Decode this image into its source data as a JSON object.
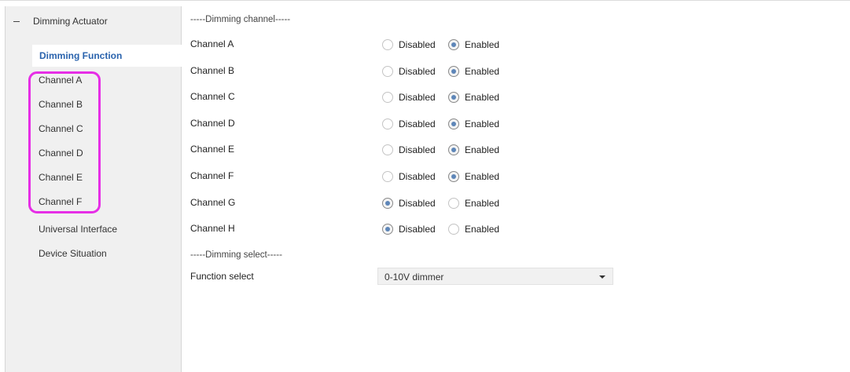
{
  "sidebar": {
    "root_label": "Dimming Actuator",
    "items": [
      {
        "label": "Dimming Function"
      },
      {
        "label": "Channel A"
      },
      {
        "label": "Channel B"
      },
      {
        "label": "Channel C"
      },
      {
        "label": "Channel D"
      },
      {
        "label": "Channel E"
      },
      {
        "label": "Channel F"
      },
      {
        "label": "Universal Interface"
      },
      {
        "label": "Device Situation"
      }
    ],
    "active_index": 0,
    "highlight_color": "#e62ee6",
    "active_color": "#2a63ad"
  },
  "main": {
    "section_channel": "-----Dimming channel-----",
    "option_disabled": "Disabled",
    "option_enabled": "Enabled",
    "channels": [
      {
        "label": "Channel A",
        "value": "Enabled"
      },
      {
        "label": "Channel B",
        "value": "Enabled"
      },
      {
        "label": "Channel C",
        "value": "Enabled"
      },
      {
        "label": "Channel D",
        "value": "Enabled"
      },
      {
        "label": "Channel E",
        "value": "Enabled"
      },
      {
        "label": "Channel F",
        "value": "Enabled"
      },
      {
        "label": "Channel G",
        "value": "Disabled"
      },
      {
        "label": "Channel H",
        "value": "Disabled"
      }
    ],
    "section_select": "-----Dimming select-----",
    "function_select": {
      "label": "Function select",
      "value": "0-10V dimmer"
    }
  }
}
